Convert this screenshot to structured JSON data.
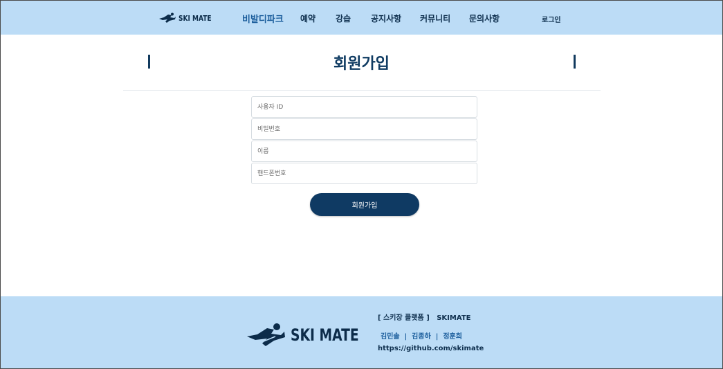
{
  "header": {
    "logo_text": "SKI MATE",
    "nav": [
      {
        "label": "비발디파크"
      },
      {
        "label": "예약"
      },
      {
        "label": "강습"
      },
      {
        "label": "공지사항"
      },
      {
        "label": "커뮤니티"
      },
      {
        "label": "문의사항"
      }
    ],
    "login_label": "로그인"
  },
  "main": {
    "title": "회원가입",
    "fields": [
      {
        "placeholder": "사용자 ID"
      },
      {
        "placeholder": "비밀번호"
      },
      {
        "placeholder": "이름"
      },
      {
        "placeholder": "핸드폰번호"
      }
    ],
    "submit_label": "회원가입"
  },
  "footer": {
    "logo_text": "SKI MATE",
    "title": "[ 스키장 플랫폼 ]   SKIMATE",
    "members": "김민솔  |  김종하  |  정훈희",
    "link": "https://github.com/skimate"
  },
  "colors": {
    "header_bg": "#bcdcf6",
    "brand_navy": "#0f3a63",
    "accent_blue": "#1d5f9d"
  }
}
